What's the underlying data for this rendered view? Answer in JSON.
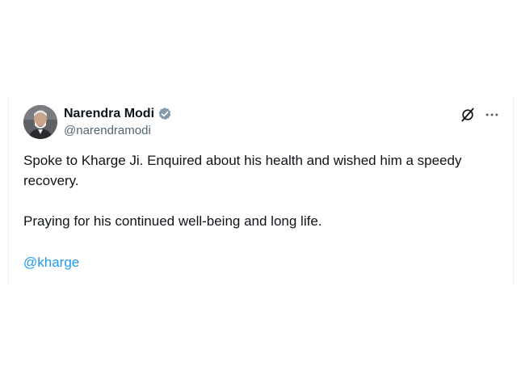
{
  "tweet": {
    "author_name": "Narendra Modi",
    "author_handle": "@narendramodi",
    "verified_icon": "verified-badge-icon",
    "paragraph_1": "Spoke to Kharge Ji. Enquired about his health and wished him a speedy recovery.",
    "paragraph_2": "Praying for his continued well-being and long life.",
    "mention": "@kharge"
  },
  "colors": {
    "text": "#0f1419",
    "secondary": "#536471",
    "accent": "#1d9bf0",
    "verified": "#829aab"
  },
  "icons": {
    "grok": "grok-icon",
    "more": "more-options-icon"
  }
}
